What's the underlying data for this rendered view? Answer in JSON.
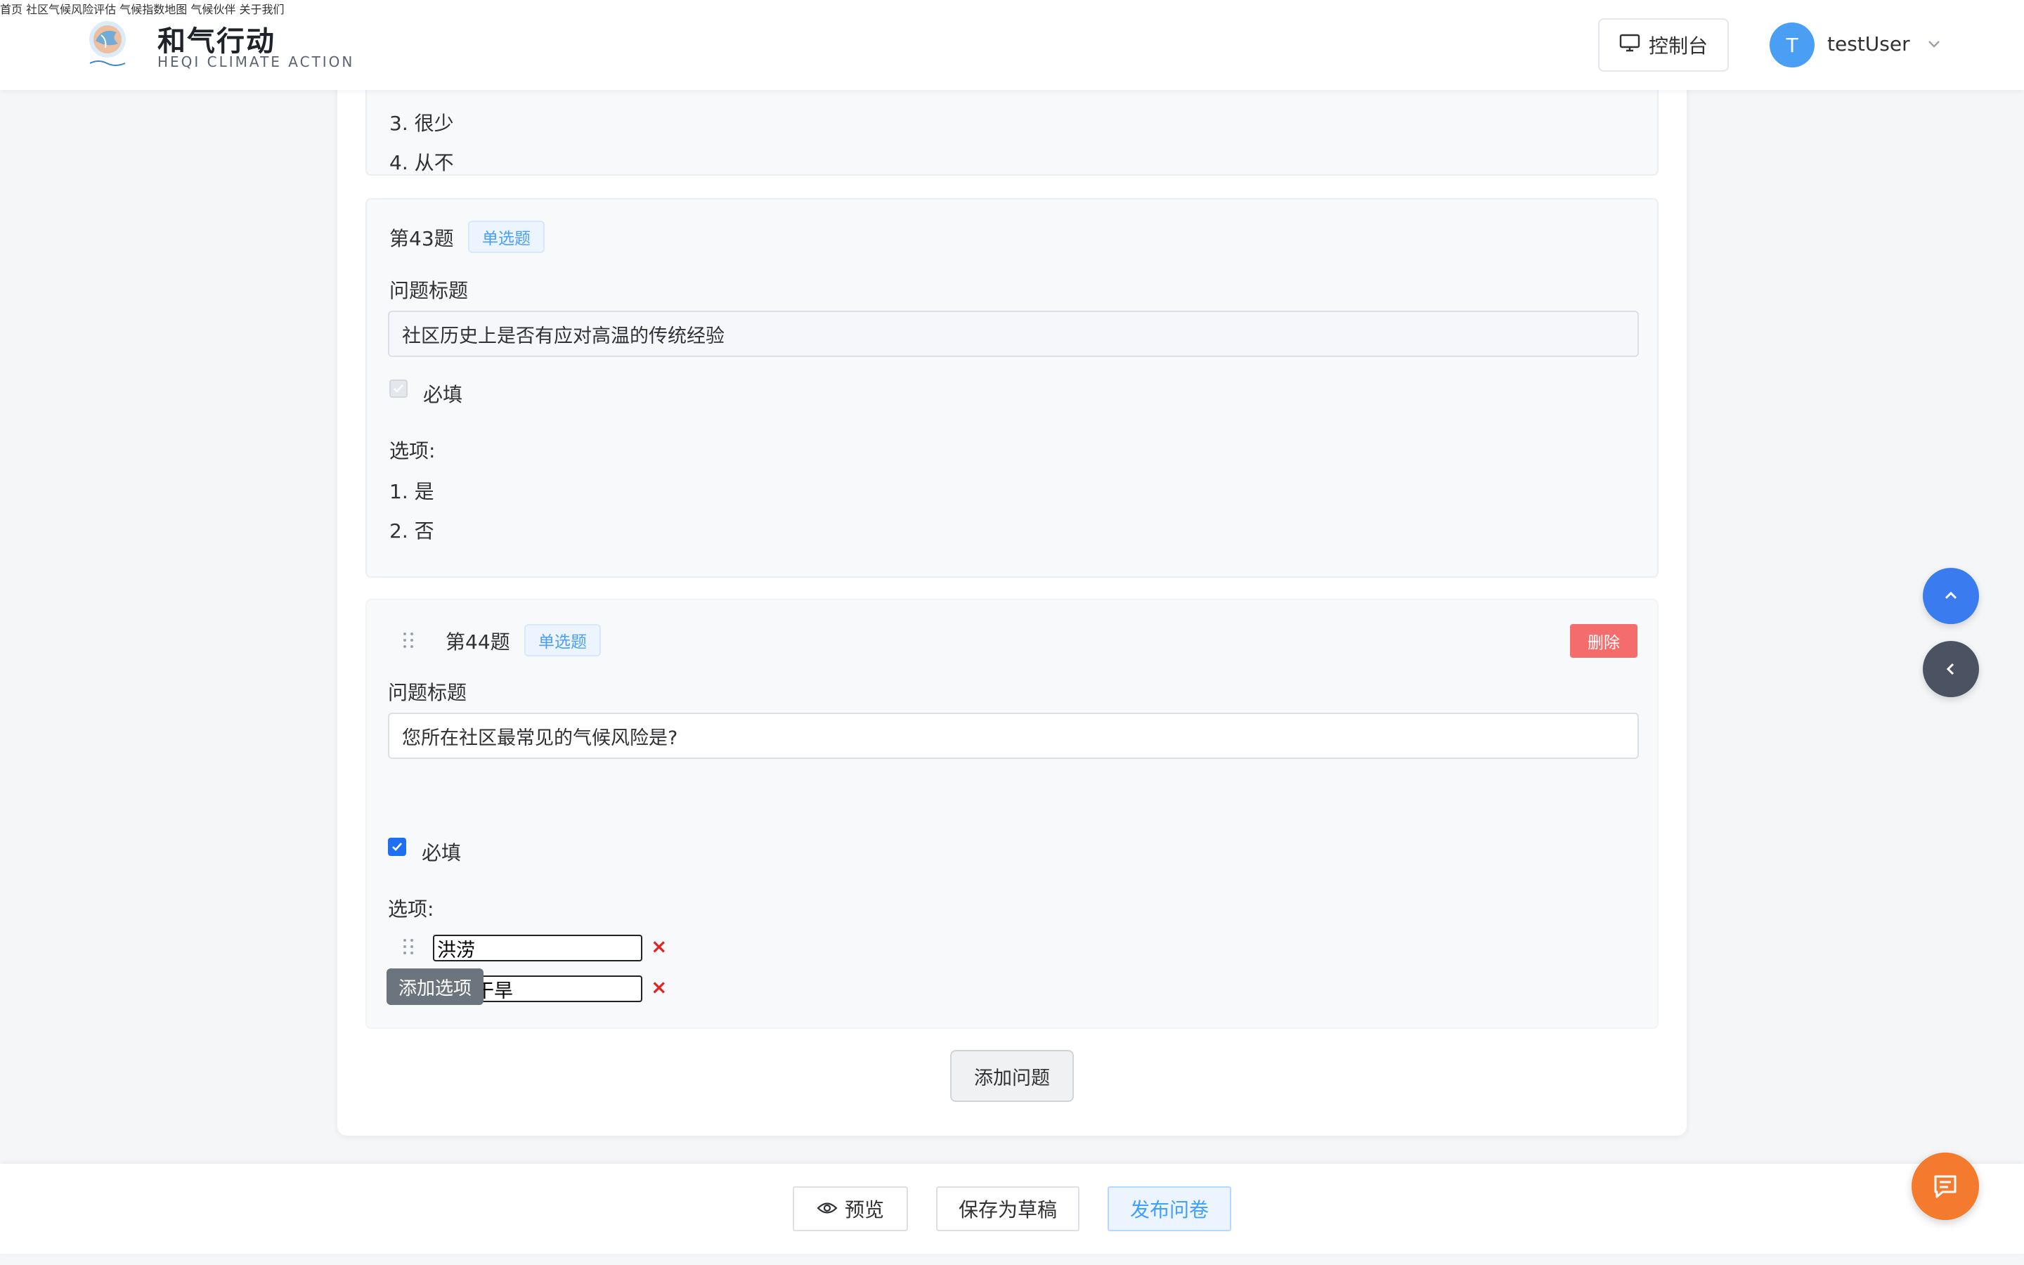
{
  "brand": {
    "name": "和气行动",
    "subtitle": "HEQI CLIMATE ACTION"
  },
  "nav": {
    "items": [
      "首页",
      "社区气候风险评估",
      "气候指数地图",
      "气候伙伴",
      "关于我们"
    ]
  },
  "header": {
    "console_label": "控制台",
    "avatar_initial": "T",
    "username": "testUser"
  },
  "question_42": {
    "options_visible": [
      "3. 很少",
      "4. 从不"
    ]
  },
  "question_43": {
    "number": "第43题",
    "type": "单选题",
    "title_label": "问题标题",
    "title_value": "社区历史上是否有应对高温的传统经验",
    "required_label": "必填",
    "options_label": "选项:",
    "options": [
      "1. 是",
      "2. 否"
    ]
  },
  "question_44": {
    "number": "第44题",
    "type": "单选题",
    "delete_label": "删除",
    "title_label": "问题标题",
    "title_value": "您所在社区最常见的气候风险是?",
    "required_label": "必填",
    "required_checked": true,
    "options_label": "选项:",
    "options": [
      "洪涝",
      "高温干旱"
    ],
    "remove_icon": "×",
    "add_option_label": "添加选项"
  },
  "add_question_label": "添加问题",
  "bottom": {
    "preview_label": "预览",
    "save_draft_label": "保存为草稿",
    "publish_label": "发布问卷"
  },
  "colors": {
    "primary": "#409eff",
    "danger": "#f56c6c",
    "float_up": "#3b7bf0",
    "float_back": "#4b5261",
    "chat": "#f47a2e"
  },
  "icons": [
    "monitor-icon",
    "chevron-down-icon",
    "eye-icon",
    "chevron-up-icon",
    "chevron-left-icon",
    "chat-icon",
    "drag-handle-icon",
    "check-icon"
  ]
}
